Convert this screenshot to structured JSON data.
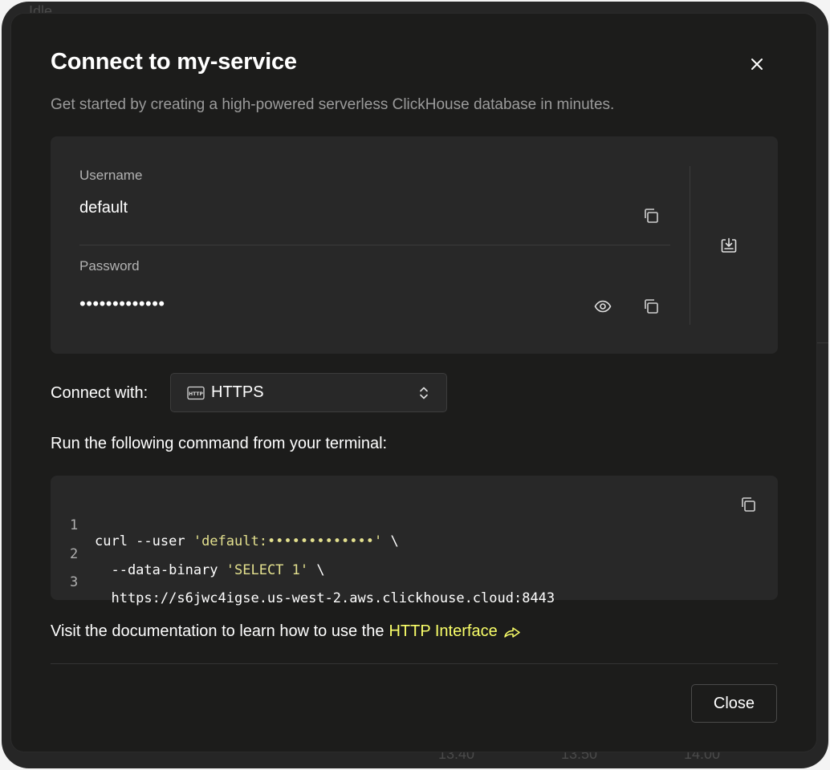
{
  "background": {
    "status_text": "Idle",
    "time_ticks": [
      "13:40",
      "13:50",
      "14:00"
    ]
  },
  "modal": {
    "title": "Connect to my-service",
    "subtitle": "Get started by creating a high-powered serverless ClickHouse database in minutes.",
    "credentials": {
      "username_label": "Username",
      "username_value": "default",
      "password_label": "Password",
      "password_masked": "•••••••••••••"
    },
    "connect_with": {
      "label": "Connect with:",
      "selected": "HTTPS",
      "selected_icon": "http-icon"
    },
    "run_label": "Run the following command from your terminal:",
    "code": {
      "lines": [
        {
          "num": "1",
          "pre": "curl --user ",
          "str": "'default:•••••••••••••'",
          "post": " \\"
        },
        {
          "num": "2",
          "pre": "  --data-binary ",
          "str": "'SELECT 1'",
          "post": " \\"
        },
        {
          "num": "3",
          "pre": "  https://s6jwc4igse.us-west-2.aws.clickhouse.cloud:8443",
          "str": "",
          "post": ""
        }
      ]
    },
    "docs": {
      "text": "Visit the documentation to learn how to use the",
      "link_text": "HTTP Interface"
    },
    "close_label": "Close"
  },
  "colors": {
    "accent_link": "#faff69",
    "code_string": "#e3e08e",
    "modal_bg": "#1c1c1b",
    "card_bg": "#282828"
  }
}
